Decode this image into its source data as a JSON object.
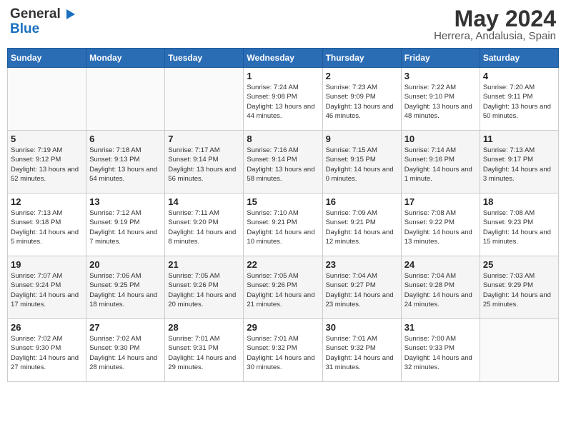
{
  "app": {
    "logo_general": "General",
    "logo_blue": "Blue",
    "title": "May 2024",
    "subtitle": "Herrera, Andalusia, Spain"
  },
  "calendar": {
    "headers": [
      "Sunday",
      "Monday",
      "Tuesday",
      "Wednesday",
      "Thursday",
      "Friday",
      "Saturday"
    ],
    "weeks": [
      [
        {
          "day": "",
          "sunrise": "",
          "sunset": "",
          "daylight": ""
        },
        {
          "day": "",
          "sunrise": "",
          "sunset": "",
          "daylight": ""
        },
        {
          "day": "",
          "sunrise": "",
          "sunset": "",
          "daylight": ""
        },
        {
          "day": "1",
          "sunrise": "Sunrise: 7:24 AM",
          "sunset": "Sunset: 9:08 PM",
          "daylight": "Daylight: 13 hours and 44 minutes."
        },
        {
          "day": "2",
          "sunrise": "Sunrise: 7:23 AM",
          "sunset": "Sunset: 9:09 PM",
          "daylight": "Daylight: 13 hours and 46 minutes."
        },
        {
          "day": "3",
          "sunrise": "Sunrise: 7:22 AM",
          "sunset": "Sunset: 9:10 PM",
          "daylight": "Daylight: 13 hours and 48 minutes."
        },
        {
          "day": "4",
          "sunrise": "Sunrise: 7:20 AM",
          "sunset": "Sunset: 9:11 PM",
          "daylight": "Daylight: 13 hours and 50 minutes."
        }
      ],
      [
        {
          "day": "5",
          "sunrise": "Sunrise: 7:19 AM",
          "sunset": "Sunset: 9:12 PM",
          "daylight": "Daylight: 13 hours and 52 minutes."
        },
        {
          "day": "6",
          "sunrise": "Sunrise: 7:18 AM",
          "sunset": "Sunset: 9:13 PM",
          "daylight": "Daylight: 13 hours and 54 minutes."
        },
        {
          "day": "7",
          "sunrise": "Sunrise: 7:17 AM",
          "sunset": "Sunset: 9:14 PM",
          "daylight": "Daylight: 13 hours and 56 minutes."
        },
        {
          "day": "8",
          "sunrise": "Sunrise: 7:16 AM",
          "sunset": "Sunset: 9:14 PM",
          "daylight": "Daylight: 13 hours and 58 minutes."
        },
        {
          "day": "9",
          "sunrise": "Sunrise: 7:15 AM",
          "sunset": "Sunset: 9:15 PM",
          "daylight": "Daylight: 14 hours and 0 minutes."
        },
        {
          "day": "10",
          "sunrise": "Sunrise: 7:14 AM",
          "sunset": "Sunset: 9:16 PM",
          "daylight": "Daylight: 14 hours and 1 minute."
        },
        {
          "day": "11",
          "sunrise": "Sunrise: 7:13 AM",
          "sunset": "Sunset: 9:17 PM",
          "daylight": "Daylight: 14 hours and 3 minutes."
        }
      ],
      [
        {
          "day": "12",
          "sunrise": "Sunrise: 7:13 AM",
          "sunset": "Sunset: 9:18 PM",
          "daylight": "Daylight: 14 hours and 5 minutes."
        },
        {
          "day": "13",
          "sunrise": "Sunrise: 7:12 AM",
          "sunset": "Sunset: 9:19 PM",
          "daylight": "Daylight: 14 hours and 7 minutes."
        },
        {
          "day": "14",
          "sunrise": "Sunrise: 7:11 AM",
          "sunset": "Sunset: 9:20 PM",
          "daylight": "Daylight: 14 hours and 8 minutes."
        },
        {
          "day": "15",
          "sunrise": "Sunrise: 7:10 AM",
          "sunset": "Sunset: 9:21 PM",
          "daylight": "Daylight: 14 hours and 10 minutes."
        },
        {
          "day": "16",
          "sunrise": "Sunrise: 7:09 AM",
          "sunset": "Sunset: 9:21 PM",
          "daylight": "Daylight: 14 hours and 12 minutes."
        },
        {
          "day": "17",
          "sunrise": "Sunrise: 7:08 AM",
          "sunset": "Sunset: 9:22 PM",
          "daylight": "Daylight: 14 hours and 13 minutes."
        },
        {
          "day": "18",
          "sunrise": "Sunrise: 7:08 AM",
          "sunset": "Sunset: 9:23 PM",
          "daylight": "Daylight: 14 hours and 15 minutes."
        }
      ],
      [
        {
          "day": "19",
          "sunrise": "Sunrise: 7:07 AM",
          "sunset": "Sunset: 9:24 PM",
          "daylight": "Daylight: 14 hours and 17 minutes."
        },
        {
          "day": "20",
          "sunrise": "Sunrise: 7:06 AM",
          "sunset": "Sunset: 9:25 PM",
          "daylight": "Daylight: 14 hours and 18 minutes."
        },
        {
          "day": "21",
          "sunrise": "Sunrise: 7:05 AM",
          "sunset": "Sunset: 9:26 PM",
          "daylight": "Daylight: 14 hours and 20 minutes."
        },
        {
          "day": "22",
          "sunrise": "Sunrise: 7:05 AM",
          "sunset": "Sunset: 9:26 PM",
          "daylight": "Daylight: 14 hours and 21 minutes."
        },
        {
          "day": "23",
          "sunrise": "Sunrise: 7:04 AM",
          "sunset": "Sunset: 9:27 PM",
          "daylight": "Daylight: 14 hours and 23 minutes."
        },
        {
          "day": "24",
          "sunrise": "Sunrise: 7:04 AM",
          "sunset": "Sunset: 9:28 PM",
          "daylight": "Daylight: 14 hours and 24 minutes."
        },
        {
          "day": "25",
          "sunrise": "Sunrise: 7:03 AM",
          "sunset": "Sunset: 9:29 PM",
          "daylight": "Daylight: 14 hours and 25 minutes."
        }
      ],
      [
        {
          "day": "26",
          "sunrise": "Sunrise: 7:02 AM",
          "sunset": "Sunset: 9:30 PM",
          "daylight": "Daylight: 14 hours and 27 minutes."
        },
        {
          "day": "27",
          "sunrise": "Sunrise: 7:02 AM",
          "sunset": "Sunset: 9:30 PM",
          "daylight": "Daylight: 14 hours and 28 minutes."
        },
        {
          "day": "28",
          "sunrise": "Sunrise: 7:01 AM",
          "sunset": "Sunset: 9:31 PM",
          "daylight": "Daylight: 14 hours and 29 minutes."
        },
        {
          "day": "29",
          "sunrise": "Sunrise: 7:01 AM",
          "sunset": "Sunset: 9:32 PM",
          "daylight": "Daylight: 14 hours and 30 minutes."
        },
        {
          "day": "30",
          "sunrise": "Sunrise: 7:01 AM",
          "sunset": "Sunset: 9:32 PM",
          "daylight": "Daylight: 14 hours and 31 minutes."
        },
        {
          "day": "31",
          "sunrise": "Sunrise: 7:00 AM",
          "sunset": "Sunset: 9:33 PM",
          "daylight": "Daylight: 14 hours and 32 minutes."
        },
        {
          "day": "",
          "sunrise": "",
          "sunset": "",
          "daylight": ""
        }
      ]
    ]
  }
}
